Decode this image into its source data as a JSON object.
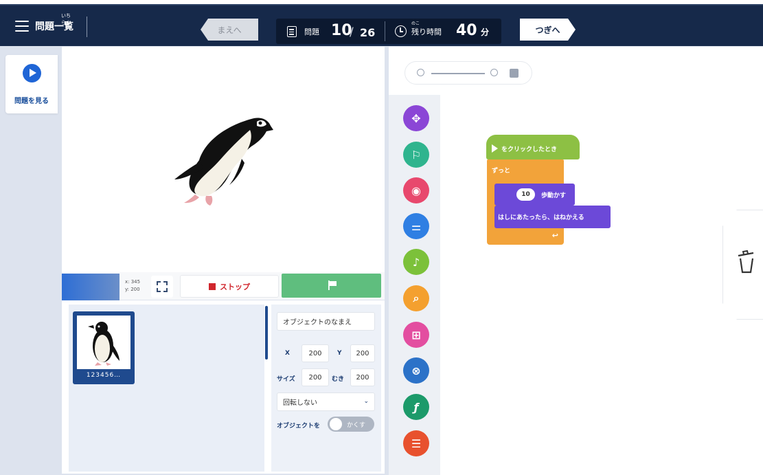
{
  "header": {
    "menu_label": "問題一覧",
    "menu_ruby": "いちらん",
    "prev_label": "まえへ",
    "next_label": "つぎへ",
    "question_label": "問題",
    "question_current": "10",
    "question_total": "26",
    "time_ruby": "のこ",
    "time_label": "残り時間",
    "time_value": "40",
    "time_unit": "分"
  },
  "sidebar": {
    "view_problem_label": "問題を見る"
  },
  "stage_controls": {
    "coord_x": "x: 345",
    "coord_y": "y: 200",
    "stop_label": "ストップ"
  },
  "sprite": {
    "name": "123456…"
  },
  "properties": {
    "object_name": "オブジェクトのなまえ",
    "x_label": "X",
    "x_value": "200",
    "y_label": "Y",
    "y_value": "200",
    "size_label": "サイズ",
    "size_value": "200",
    "direction_label": "むき",
    "direction_value": "200",
    "rotation_value": "回転しない",
    "visibility_label": "オブジェクトを",
    "visibility_value": "かくす"
  },
  "blocks": {
    "hat_label": "をクリックしたとき",
    "forever_label": "ずっと",
    "steps_value": "10",
    "move_label": "歩動かす",
    "bounce_label": "はしにあたったら、はねかえる"
  },
  "palette_icons": [
    "motion-icon",
    "events-icon",
    "looks-icon",
    "control-icon",
    "sound-icon",
    "sensing-icon",
    "variables-icon",
    "operators-icon",
    "functions-icon",
    "lists-icon"
  ],
  "colors": {
    "header_bg": "#16294a",
    "accent_blue": "#1f65d6",
    "go_green": "#5fbe7e",
    "stop_red": "#d0262d",
    "block_event": "#8dc044",
    "block_control": "#f2a33a",
    "block_motion": "#6c49d8"
  }
}
